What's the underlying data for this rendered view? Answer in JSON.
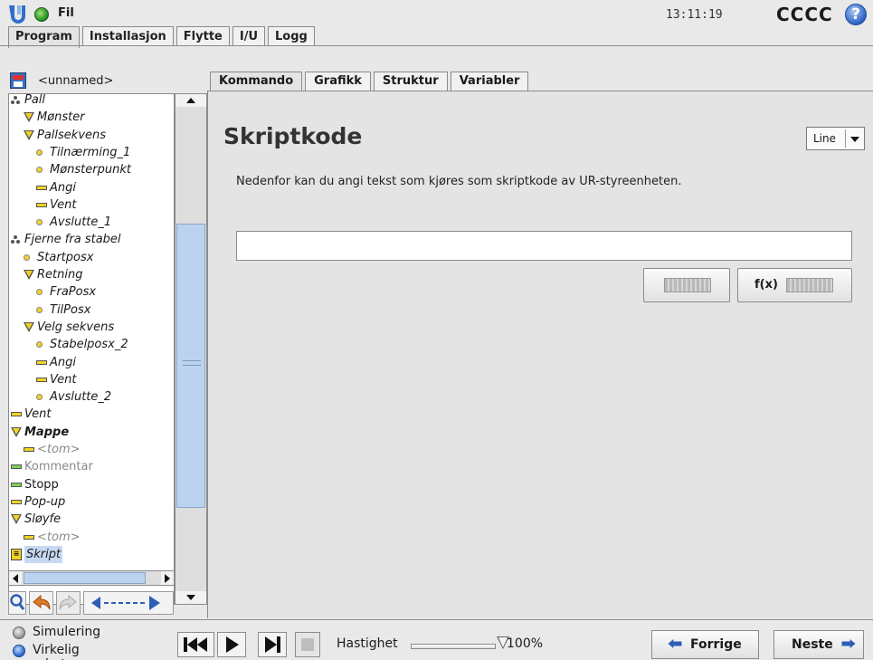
{
  "header": {
    "file_label": "Fil",
    "clock": "13:11:19",
    "robot_name": "CCCC",
    "help_glyph": "?"
  },
  "main_tabs": [
    {
      "label": "Program",
      "active": true
    },
    {
      "label": "Installasjon",
      "active": false
    },
    {
      "label": "Flytte",
      "active": false
    },
    {
      "label": "I/U",
      "active": false
    },
    {
      "label": "Logg",
      "active": false
    }
  ],
  "program": {
    "name": "<unnamed>"
  },
  "tree": [
    {
      "label": "Pall",
      "style": "it",
      "icon": "pallet-icon"
    },
    {
      "label": "Mønster",
      "style": "it",
      "icon": "folder-triangle-icon"
    },
    {
      "label": "Pallsekvens",
      "style": "it",
      "icon": "folder-triangle-icon"
    },
    {
      "label": "Tilnærming_1",
      "style": "it",
      "icon": "waypoint-icon"
    },
    {
      "label": "Mønsterpunkt",
      "style": "it",
      "icon": "waypoint-icon"
    },
    {
      "label": "Angi",
      "style": "it",
      "icon": "set-icon"
    },
    {
      "label": "Vent",
      "style": "it",
      "icon": "wait-icon"
    },
    {
      "label": "Avslutte_1",
      "style": "it",
      "icon": "waypoint-icon"
    },
    {
      "label": "Fjerne fra stabel",
      "style": "it",
      "icon": "pallet-icon"
    },
    {
      "label": "Startposx",
      "style": "it",
      "icon": "waypoint-icon"
    },
    {
      "label": "Retning",
      "style": "it",
      "icon": "folder-triangle-icon"
    },
    {
      "label": "FraPosx",
      "style": "it",
      "icon": "waypoint-icon"
    },
    {
      "label": "TilPosx",
      "style": "it",
      "icon": "waypoint-icon"
    },
    {
      "label": "Velg sekvens",
      "style": "it",
      "icon": "folder-triangle-icon"
    },
    {
      "label": "Stabelposx_2",
      "style": "it",
      "icon": "waypoint-icon"
    },
    {
      "label": "Angi",
      "style": "it",
      "icon": "set-icon"
    },
    {
      "label": "Vent",
      "style": "it",
      "icon": "wait-icon"
    },
    {
      "label": "Avslutte_2",
      "style": "it",
      "icon": "waypoint-icon"
    },
    {
      "label": "Vent",
      "style": "it",
      "icon": "wait-icon"
    },
    {
      "label": "Mappe",
      "style": "it bold",
      "icon": "folder-triangle-icon"
    },
    {
      "label": "<tom>",
      "style": "it grey",
      "icon": "empty-icon"
    },
    {
      "label": "Kommentar",
      "style": "grey",
      "icon": "comment-icon"
    },
    {
      "label": "Stopp",
      "style": "",
      "icon": "stop-icon"
    },
    {
      "label": "Pop-up",
      "style": "it",
      "icon": "popup-icon"
    },
    {
      "label": "Sløyfe",
      "style": "it",
      "icon": "loop-icon"
    },
    {
      "label": "<tom>",
      "style": "it grey",
      "icon": "empty-icon"
    },
    {
      "label": "Skript",
      "style": "it sel",
      "icon": "script-icon"
    }
  ],
  "sub_tabs": [
    {
      "label": "Kommando",
      "active": true
    },
    {
      "label": "Grafikk",
      "active": false
    },
    {
      "label": "Struktur",
      "active": false
    },
    {
      "label": "Variabler",
      "active": false
    }
  ],
  "command": {
    "title": "Skriptkode",
    "mode_select": "Line",
    "description": "Nedenfor kan du angi tekst som kjøres som skriptkode av UR-styreenheten.",
    "script_value": "",
    "fx_label": "f(x)"
  },
  "footer": {
    "simulation": "Simulering",
    "real_robot": "Virkelig robot",
    "speed_label": "Hastighet",
    "speed_value": "100%",
    "speed_fraction": 1.0,
    "prev": "Forrige",
    "next": "Neste"
  },
  "colors": {
    "accent": "#2c5fb4",
    "selection": "#c7d8f3",
    "node_yellow": "#f1d327"
  }
}
